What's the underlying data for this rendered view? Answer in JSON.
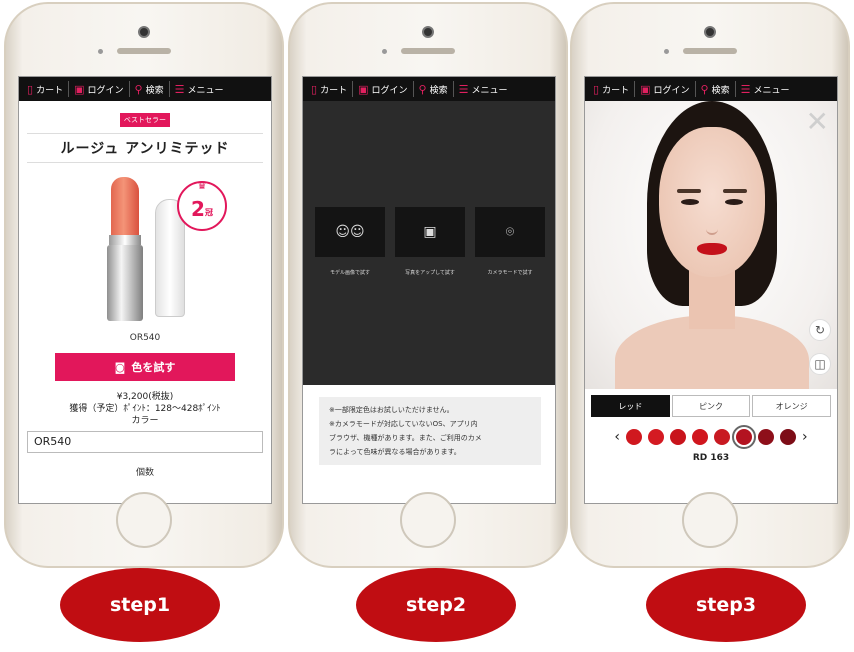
{
  "nav": {
    "items": [
      {
        "icon": "cart-icon",
        "label": "カート"
      },
      {
        "icon": "login-icon",
        "label": "ログイン"
      },
      {
        "icon": "search-icon",
        "label": "検索"
      },
      {
        "icon": "menu-icon",
        "label": "メニュー"
      }
    ]
  },
  "step1": {
    "badge": "ベストセラー",
    "title": "ルージュ アンリミテッド",
    "rank_number": "2",
    "rank_suffix": "冠",
    "shade": "OR540",
    "try_button": "色を試す",
    "price": "¥3,200(税抜)",
    "points": "獲得（予定）ﾎﾟｲﾝﾄ：128〜428ﾎﾟｲﾝﾄ",
    "color_label": "カラー",
    "color_value": "OR540",
    "qty_label": "個数"
  },
  "step2": {
    "options": [
      {
        "label": "モデル画像で試す",
        "icon": "models-icon"
      },
      {
        "label": "写真をアップして試す",
        "icon": "upload-photo-icon"
      },
      {
        "label": "カメラモードで試す",
        "icon": "camera-face-icon"
      }
    ],
    "note_lines": [
      "※一部限定色はお試しいただけません。",
      "※カメラモードが対応していないOS、アプリ内",
      "ブラウザ、機種があります。また、ご利用のカメ",
      "ラによって色味が異なる場合があります。"
    ]
  },
  "step3": {
    "tabs": [
      "レッド",
      "ピンク",
      "オレンジ"
    ],
    "active_tab": "レッド",
    "swatch_colors": [
      "#d0181f",
      "#d41a22",
      "#c8141c",
      "#d0161e",
      "#c81a22",
      "#b31320",
      "#8e0f1a",
      "#7d0d17"
    ],
    "selected_swatch_index": 5,
    "shade_label": "RD 163"
  },
  "steps": [
    "step1",
    "step2",
    "step3"
  ],
  "colors": {
    "accent": "#e2175b",
    "step_red": "#c00d12"
  }
}
